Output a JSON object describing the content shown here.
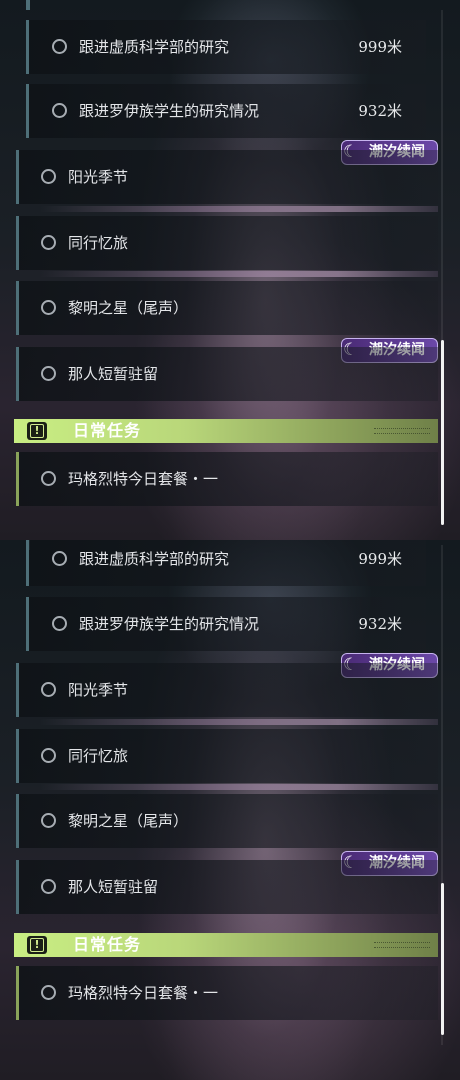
{
  "quests": {
    "sub1": {
      "label": "跟进虚质科学部的研究",
      "distance": "999米"
    },
    "sub2": {
      "label": "跟进罗伊族学生的研究情况",
      "distance": "932米"
    },
    "main1": {
      "label": "阳光季节"
    },
    "main2": {
      "label": "同行忆旅"
    },
    "main3": {
      "label": "黎明之星（尾声）"
    },
    "main4": {
      "label": "那人短暂驻留"
    }
  },
  "event_tag": {
    "label": "潮汐续闻",
    "icon": "moon-star-icon"
  },
  "daily": {
    "header": "日常任务",
    "header_icon": "exclamation-icon",
    "item1": {
      "label": "玛格烈特今日套餐・一"
    }
  },
  "colors": {
    "tag_purple": "#5b3a90",
    "daily_green": "#c9ee83",
    "quest_accent": "#4e6f78"
  }
}
